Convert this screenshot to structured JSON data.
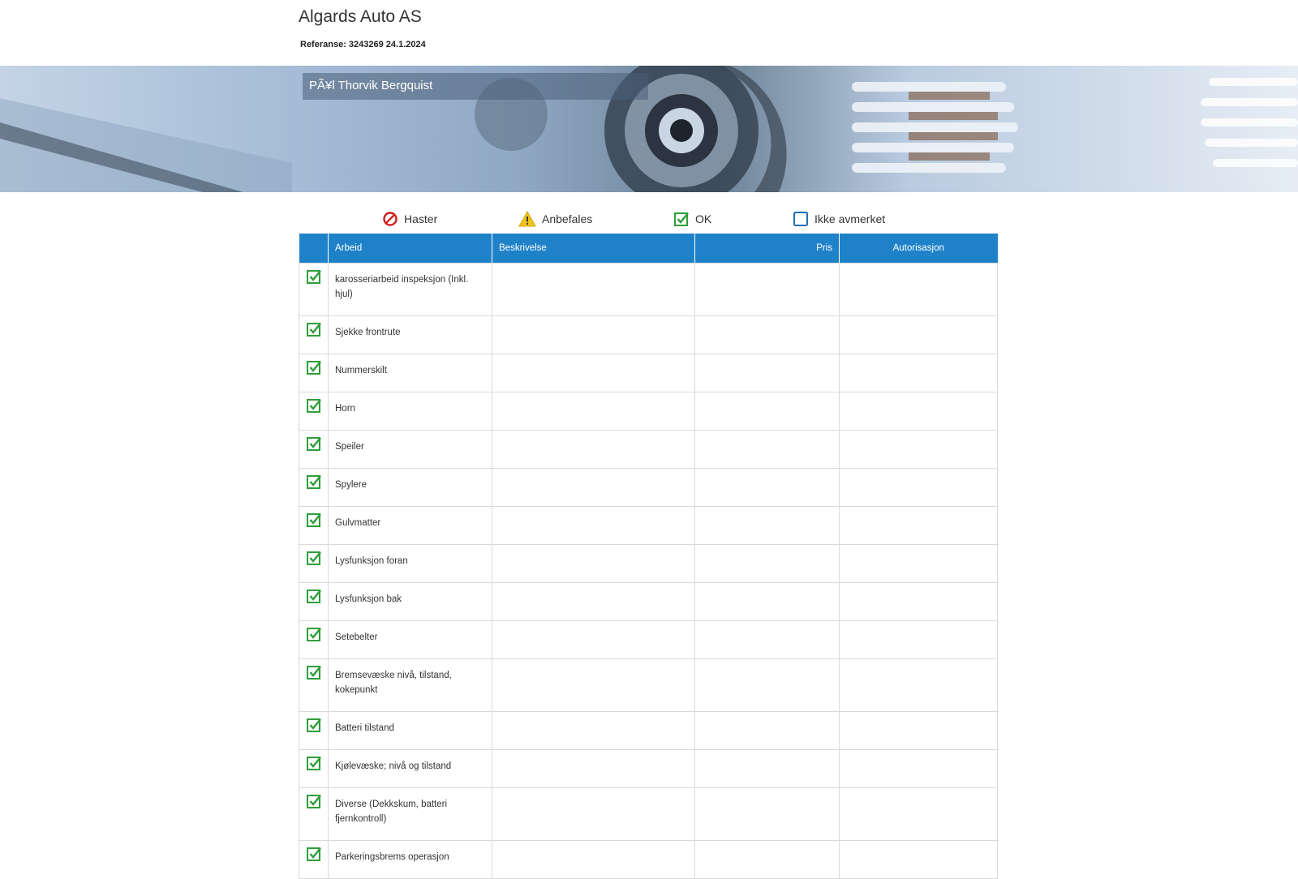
{
  "header": {
    "company": "Algards Auto AS",
    "reference": "Referanse: 3243269 24.1.2024"
  },
  "banner": {
    "customer_name": "PÃ¥l Thorvik Bergquist"
  },
  "legend": [
    {
      "label": "Haster",
      "icon": "prohibited-icon",
      "color": "#d01f1f"
    },
    {
      "label": "Anbefales",
      "icon": "warning-icon",
      "color": "#f0c419"
    },
    {
      "label": "OK",
      "icon": "checked-box-icon",
      "color": "#2e9e3a"
    },
    {
      "label": "Ikke avmerket",
      "icon": "empty-box-icon",
      "color": "#1f6fb5"
    }
  ],
  "table": {
    "headers": {
      "arbeid": "Arbeid",
      "beskrivelse": "Beskrivelse",
      "pris": "Pris",
      "autorisasjon": "Autorisasjon"
    },
    "header_color": "#1f82c9",
    "rows": [
      {
        "status": "ok",
        "arbeid": "karosseriarbeid inspeksjon (Inkl. hjul)",
        "beskrivelse": "",
        "pris": "",
        "autorisasjon": ""
      },
      {
        "status": "ok",
        "arbeid": "Sjekke frontrute",
        "beskrivelse": "",
        "pris": "",
        "autorisasjon": ""
      },
      {
        "status": "ok",
        "arbeid": "Nummerskilt",
        "beskrivelse": "",
        "pris": "",
        "autorisasjon": ""
      },
      {
        "status": "ok",
        "arbeid": "Horn",
        "beskrivelse": "",
        "pris": "",
        "autorisasjon": ""
      },
      {
        "status": "ok",
        "arbeid": "Speiler",
        "beskrivelse": "",
        "pris": "",
        "autorisasjon": ""
      },
      {
        "status": "ok",
        "arbeid": "Spylere",
        "beskrivelse": "",
        "pris": "",
        "autorisasjon": ""
      },
      {
        "status": "ok",
        "arbeid": "Gulvmatter",
        "beskrivelse": "",
        "pris": "",
        "autorisasjon": ""
      },
      {
        "status": "ok",
        "arbeid": "Lysfunksjon foran",
        "beskrivelse": "",
        "pris": "",
        "autorisasjon": ""
      },
      {
        "status": "ok",
        "arbeid": "Lysfunksjon bak",
        "beskrivelse": "",
        "pris": "",
        "autorisasjon": ""
      },
      {
        "status": "ok",
        "arbeid": "Setebelter",
        "beskrivelse": "",
        "pris": "",
        "autorisasjon": ""
      },
      {
        "status": "ok",
        "arbeid": "Bremsevæske nivå, tilstand, kokepunkt",
        "beskrivelse": "",
        "pris": "",
        "autorisasjon": ""
      },
      {
        "status": "ok",
        "arbeid": "Batteri tilstand",
        "beskrivelse": "",
        "pris": "",
        "autorisasjon": ""
      },
      {
        "status": "ok",
        "arbeid": "Kjølevæske; nivå og tilstand",
        "beskrivelse": "",
        "pris": "",
        "autorisasjon": ""
      },
      {
        "status": "ok",
        "arbeid": "Diverse (Dekkskum, batteri fjernkontroll)",
        "beskrivelse": "",
        "pris": "",
        "autorisasjon": ""
      },
      {
        "status": "ok",
        "arbeid": "Parkeringsbrems operasjon",
        "beskrivelse": "",
        "pris": "",
        "autorisasjon": ""
      }
    ]
  }
}
